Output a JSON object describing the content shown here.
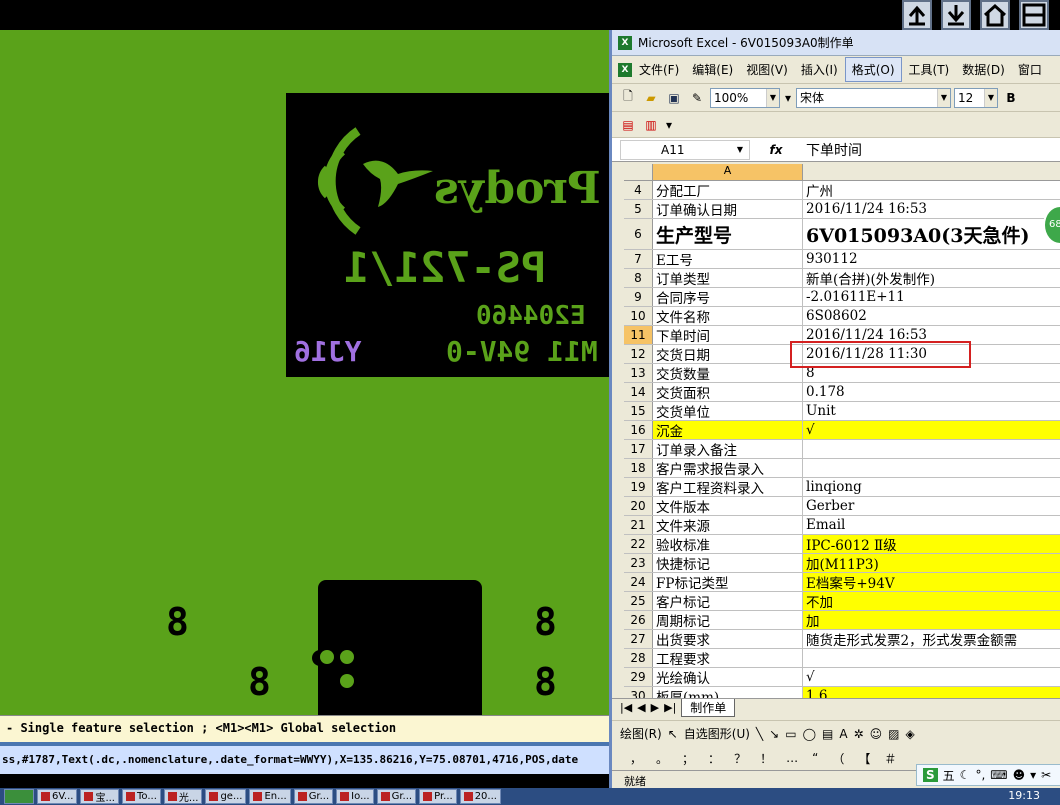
{
  "cam": {
    "logo_brand": "Prodys",
    "logo_part": "PS-721/1",
    "logo_code": "E204460",
    "logo_cert": "M11 94V-0",
    "logo_date": "YJ16",
    "pad_digit": "8",
    "status_text": " - Single feature selection ; <M1><M1> Global selection",
    "command_text": "ss,#1787,Text(.dc,.nomenclature,.date_format=WWYY),X=135.86216,Y=75.08701,4716,POS,date"
  },
  "excel": {
    "window_title": "Microsoft Excel - 6V015093A0制作单",
    "menu": [
      "文件(F)",
      "编辑(E)",
      "视图(V)",
      "插入(I)",
      "格式(O)",
      "工具(T)",
      "数据(D)",
      "窗口"
    ],
    "active_menu": "格式(O)",
    "zoom": "100%",
    "font_name": "宋体",
    "font_size": "12",
    "bold_label": "B",
    "name_box": "A11",
    "fx_label": "fx",
    "formula_value": "下单时间",
    "column_a": "A",
    "rows": [
      {
        "n": "4",
        "a": "分配工厂",
        "b": "广州"
      },
      {
        "n": "5",
        "a": "订单确认日期",
        "b": "2016/11/24 16:53"
      },
      {
        "n": "6",
        "a": "生产型号",
        "b": "6V015093A0(3天急件)"
      },
      {
        "n": "7",
        "a": "E工号",
        "b": "930112"
      },
      {
        "n": "8",
        "a": "订单类型",
        "b": "新单(合拼)(外发制作)"
      },
      {
        "n": "9",
        "a": "合同序号",
        "b": "-2.01611E+11"
      },
      {
        "n": "10",
        "a": "文件名称",
        "b": "6S08602"
      },
      {
        "n": "11",
        "a": "下单时间",
        "b": "2016/11/24 16:53"
      },
      {
        "n": "12",
        "a": "交货日期",
        "b": "2016/11/28 11:30"
      },
      {
        "n": "13",
        "a": "交货数量",
        "b": "8"
      },
      {
        "n": "14",
        "a": "交货面积",
        "b": "0.178"
      },
      {
        "n": "15",
        "a": "交货单位",
        "b": "Unit"
      },
      {
        "n": "16",
        "a": "沉金",
        "b": "√"
      },
      {
        "n": "17",
        "a": "订单录入备注",
        "b": ""
      },
      {
        "n": "18",
        "a": "客户需求报告录入",
        "b": ""
      },
      {
        "n": "19",
        "a": "客户工程资料录入",
        "b": "linqiong"
      },
      {
        "n": "20",
        "a": "文件版本",
        "b": "Gerber"
      },
      {
        "n": "21",
        "a": "文件来源",
        "b": "Email"
      },
      {
        "n": "22",
        "a": "验收标准",
        "b": "IPC-6012 Ⅱ级"
      },
      {
        "n": "23",
        "a": "快捷标记",
        "b": "加(M11P3)"
      },
      {
        "n": "24",
        "a": "FP标记类型",
        "b": "E档案号+94V"
      },
      {
        "n": "25",
        "a": "客户标记",
        "b": "不加"
      },
      {
        "n": "26",
        "a": "周期标记",
        "b": "加"
      },
      {
        "n": "27",
        "a": "出货要求",
        "b": "随货走形式发票2，形式发票金额需"
      },
      {
        "n": "28",
        "a": "工程要求",
        "b": ""
      },
      {
        "n": "29",
        "a": "光绘确认",
        "b": "√"
      },
      {
        "n": "30",
        "a": "板厚(mm)",
        "b": "1.6"
      }
    ],
    "sheet_tab": "制作单",
    "draw_label": "绘图(R)",
    "autoshape_label": "自选图形(U)",
    "status": "就绪",
    "ime_label": "五",
    "bubble": "68"
  },
  "taskbar": {
    "items": [
      "6V...",
      "宝...",
      "To...",
      "光...",
      "ge...",
      "En...",
      "Gr...",
      "Io...",
      "Gr...",
      "Pr...",
      "20..."
    ],
    "clock": "19:13"
  }
}
